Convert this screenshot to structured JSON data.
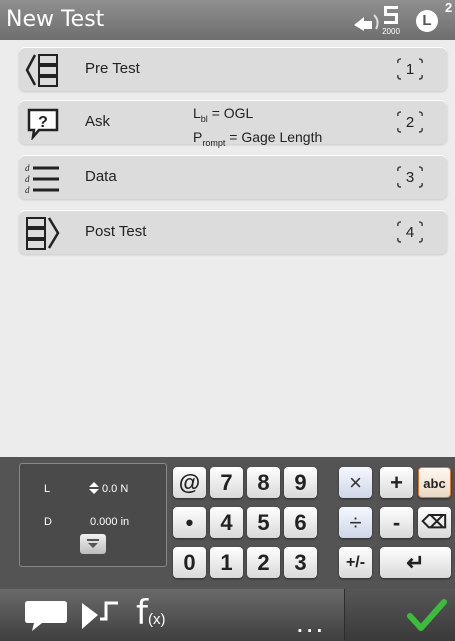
{
  "header": {
    "title": "New Test",
    "speed_value": "2000",
    "badge_letter": "L",
    "badge_count": "2"
  },
  "steps": [
    {
      "label": "Pre Test",
      "number": "1",
      "icon": "pre-test-icon"
    },
    {
      "label": "Ask",
      "number": "2",
      "icon": "question-bubble-icon",
      "extra_line1_main": "L",
      "extra_line1_sub": "bl",
      "extra_line1_rest": " = OGL",
      "extra_line2_main": "P",
      "extra_line2_sub": "rompt",
      "extra_line2_rest": " = Gage Length"
    },
    {
      "label": "Data",
      "number": "3",
      "icon": "data-list-icon"
    },
    {
      "label": "Post Test",
      "number": "4",
      "icon": "post-test-icon"
    }
  ],
  "readout": {
    "load_label": "L",
    "load_value": "0.0 N",
    "disp_label": "D",
    "disp_value": "0.000 in"
  },
  "keypad": {
    "row1": [
      "@",
      "7",
      "8",
      "9",
      "×",
      "+",
      "abc"
    ],
    "row2": [
      "•",
      "4",
      "5",
      "6",
      "÷",
      "-",
      "⌫"
    ],
    "row3": [
      "0",
      "1",
      "2",
      "3",
      "+/-",
      "↵"
    ]
  },
  "toolbar": {
    "function_label": "f",
    "function_arg": "(x)",
    "more_label": "..."
  },
  "colors": {
    "accent_check": "#3dbb3d",
    "abc_border": "#d9783a"
  }
}
